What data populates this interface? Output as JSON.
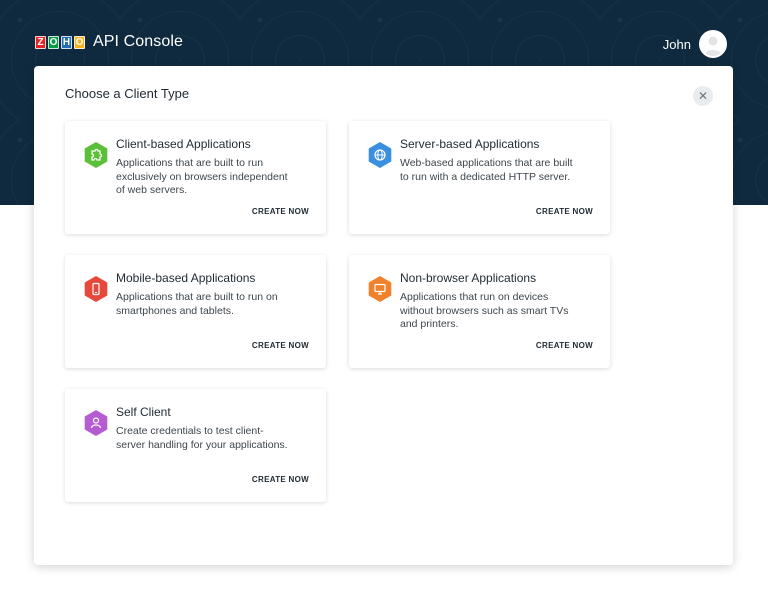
{
  "header": {
    "logo_letters": [
      "Z",
      "O",
      "H",
      "O"
    ],
    "logo_colors": [
      "#e42527",
      "#089949",
      "#226db4",
      "#f9b21d"
    ],
    "app_title": "API Console",
    "user_name": "John"
  },
  "modal": {
    "title": "Choose a Client Type",
    "close_icon": "close-icon",
    "cards": [
      {
        "title": "Client-based Applications",
        "description": "Applications that are built to run exclusively on browsers independent of web servers.",
        "cta": "CREATE NOW",
        "icon": "puzzle-icon",
        "color": "#5cbf3a"
      },
      {
        "title": "Server-based Applications",
        "description": "Web-based applications that are built to run with a dedicated HTTP server.",
        "cta": "CREATE NOW",
        "icon": "globe-icon",
        "color": "#3b8fe0"
      },
      {
        "title": "Mobile-based Applications",
        "description": "Applications that are built to run on smartphones and tablets.",
        "cta": "CREATE NOW",
        "icon": "mobile-icon",
        "color": "#e8483b"
      },
      {
        "title": "Non-browser Applications",
        "description": "Applications that run on devices without browsers such as smart TVs and printers.",
        "cta": "CREATE NOW",
        "icon": "tv-icon",
        "color": "#f0822e"
      },
      {
        "title": "Self Client",
        "description": "Create credentials to test client-server handling for your applications.",
        "cta": "CREATE NOW",
        "icon": "user-icon",
        "color": "#b55cd3"
      }
    ]
  }
}
